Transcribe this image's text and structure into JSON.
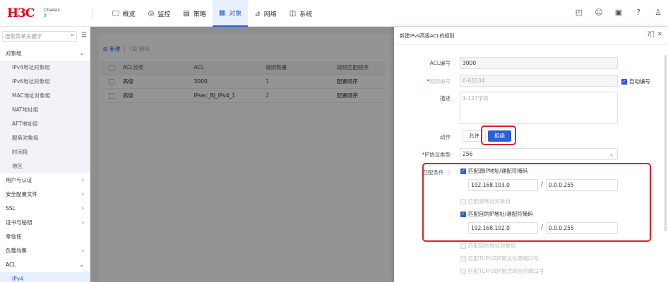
{
  "brand": {
    "logo": "H3C",
    "sub_line1": "Chassis",
    "sub_line2": "0"
  },
  "nav": [
    {
      "label": "概览",
      "icon": "🖵"
    },
    {
      "label": "监控",
      "icon": "◎"
    },
    {
      "label": "策略",
      "icon": "▤"
    },
    {
      "label": "对象",
      "icon": "▦"
    },
    {
      "label": "网络",
      "icon": "⊿"
    },
    {
      "label": "系统",
      "icon": "◫"
    }
  ],
  "top_icons": [
    "◰",
    "☺",
    "▣",
    "?",
    "♙"
  ],
  "sidebar": {
    "search_placeholder": "搜索菜单关键字",
    "items": [
      {
        "label": "对象组",
        "arrow": "⌄"
      },
      {
        "label": "IPv4地址对象组"
      },
      {
        "label": "IPv6地址对象组"
      },
      {
        "label": "MAC地址对象组"
      },
      {
        "label": "NAT地址组"
      },
      {
        "label": "AFT地址组"
      },
      {
        "label": "服务对象组"
      },
      {
        "label": "时间段"
      },
      {
        "label": "地区"
      },
      {
        "label": "用户与认证",
        "arrow": "›"
      },
      {
        "label": "安全配置文件",
        "arrow": "›"
      },
      {
        "label": "SSL",
        "arrow": "›"
      },
      {
        "label": "证书与秘钥",
        "arrow": "›"
      },
      {
        "label": "零信任"
      },
      {
        "label": "负载均衡",
        "arrow": "›"
      },
      {
        "label": "ACL",
        "arrow": "⌄"
      },
      {
        "label": "IPv4"
      }
    ]
  },
  "main": {
    "new_label": "新建",
    "delete_label": "删除",
    "columns": [
      "ACL分类",
      "ACL",
      "规则数量",
      "规则匹配顺序"
    ],
    "rows": [
      [
        "高级",
        "3000",
        "1",
        "配置顺序"
      ],
      [
        "高级",
        "IPsec_BJ_IPv4_1",
        "2",
        "配置顺序"
      ]
    ]
  },
  "drawer": {
    "title": "新建IPv4高级ACL的规则",
    "acl_label": "ACL编号",
    "acl_value": "3000",
    "rule_label": "规则编号",
    "rule_placeholder": "0-65534",
    "auto_label": "自动编号",
    "desc_label": "描述",
    "desc_placeholder": "1-127字符",
    "action_label": "动作",
    "permit_label": "允许",
    "deny_label": "拒绝",
    "proto_label": "IP协议类型",
    "proto_value": "256",
    "match_label": "匹配条件",
    "src_check_label": "匹配源IP地址/通配符掩码",
    "src_ip": "192.168.103.0",
    "src_mask": "0.0.0.255",
    "src_obj_label": "匹配源地址对象组",
    "dst_check_label": "匹配目的IP地址/通配符掩码",
    "dst_ip": "192.168.102.0",
    "dst_mask": "0.0.0.255",
    "dst_obj_label": "匹配目的地址对象组",
    "tcp_src_label": "匹配TCP/UDP报文的源端口号",
    "tcp_dst_label": "匹配TCP/UDP报文的目的端口号"
  }
}
